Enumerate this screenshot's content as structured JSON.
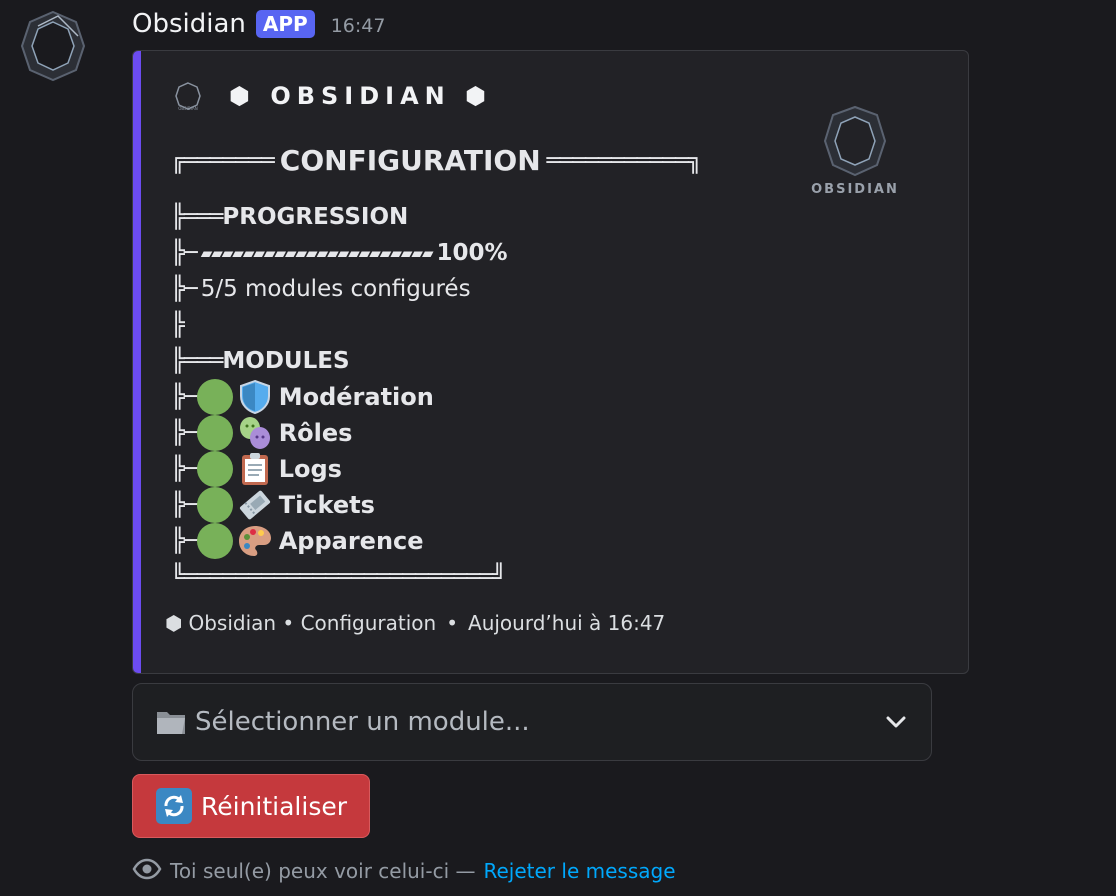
{
  "message": {
    "username": "Obsidian",
    "badge": "APP",
    "timestamp": "16:47"
  },
  "embed": {
    "accent_color": "#6c4cf0",
    "author": {
      "name": "OBSIDIAN",
      "prefix": "⬢",
      "suffix": "⬢",
      "icon_text": "OBSIDIAN"
    },
    "thumbnail_text": "OBSIDIAN",
    "header": {
      "left_tree": "╔═══════",
      "title": "CONFIGURATION",
      "right_tree": "═══════════╗"
    },
    "progression": {
      "tree": "╠═══",
      "title": "PROGRESSION",
      "bar_tree": "╠─",
      "bar": "▰▰▰▰▰▰▰▰▰▰▰▰▰▰▰▰▰▰▰▰▰▰",
      "percent": "100%",
      "count_tree": "╠─",
      "count_text": "5/5 modules configurés",
      "blank_tree": "╠"
    },
    "modules": {
      "tree": "╠═══",
      "title": "MODULES",
      "items": [
        {
          "tree": "╠─",
          "status": "green",
          "icon": "shield-icon",
          "label": "Modération"
        },
        {
          "tree": "╠─",
          "status": "green",
          "icon": "theater-masks-icon",
          "label": "Rôles"
        },
        {
          "tree": "╠─",
          "status": "green",
          "icon": "clipboard-icon",
          "label": "Logs"
        },
        {
          "tree": "╠─",
          "status": "green",
          "icon": "ticket-icon",
          "label": "Tickets"
        },
        {
          "tree": "╠─",
          "status": "green",
          "icon": "palette-icon",
          "label": "Apparence"
        }
      ]
    },
    "bottom_tree": "╚════════════════════════╝",
    "footer": {
      "icon": "⬢",
      "text": "Obsidian • Configuration",
      "separator": "•",
      "time": "Aujourd’hui à 16:47"
    }
  },
  "select": {
    "placeholder": "Sélectionner un module...",
    "icon": "folder-icon"
  },
  "reset_button": {
    "label": "Réinitialiser",
    "icon": "refresh-icon",
    "color": "#c5393d"
  },
  "ephemeral": {
    "text": "Toi seul(e) peux voir celui-ci —",
    "dismiss_link": "Rejeter le message"
  },
  "colors": {
    "status_green": "#78b159",
    "link": "#00a8fc",
    "badge": "#5865f2"
  }
}
